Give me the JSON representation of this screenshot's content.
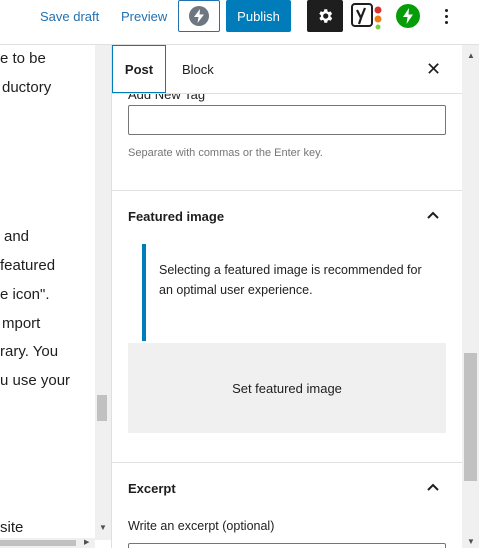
{
  "toolbar": {
    "save_draft_label": "Save draft",
    "preview_label": "Preview",
    "publish_label": "Publish"
  },
  "editor": {
    "lines": [
      "e to be",
      "ductory",
      "and",
      "featured",
      "e icon\".",
      "mport",
      "rary. You",
      "u use your",
      "site"
    ]
  },
  "sidebar": {
    "tabs": [
      {
        "label": "Post",
        "active": true
      },
      {
        "label": "Block",
        "active": false
      }
    ],
    "tags": {
      "clipped_label": "Add New Tag",
      "help": "Separate with commas or the Enter key."
    },
    "featured_image": {
      "title": "Featured image",
      "notice": "Selecting a featured image is recommended for an optimal user experience.",
      "button_label": "Set featured image"
    },
    "excerpt": {
      "title": "Excerpt",
      "label": "Write an excerpt (optional)"
    }
  },
  "colors": {
    "accent": "#007cba",
    "link": "#2271b1",
    "jetpack": "#069e08"
  },
  "icons": [
    "bolt-icon",
    "gear-icon",
    "yoast-icon",
    "jetpack-icon",
    "more-vertical-icon",
    "close-icon",
    "chevron-up-icon"
  ]
}
